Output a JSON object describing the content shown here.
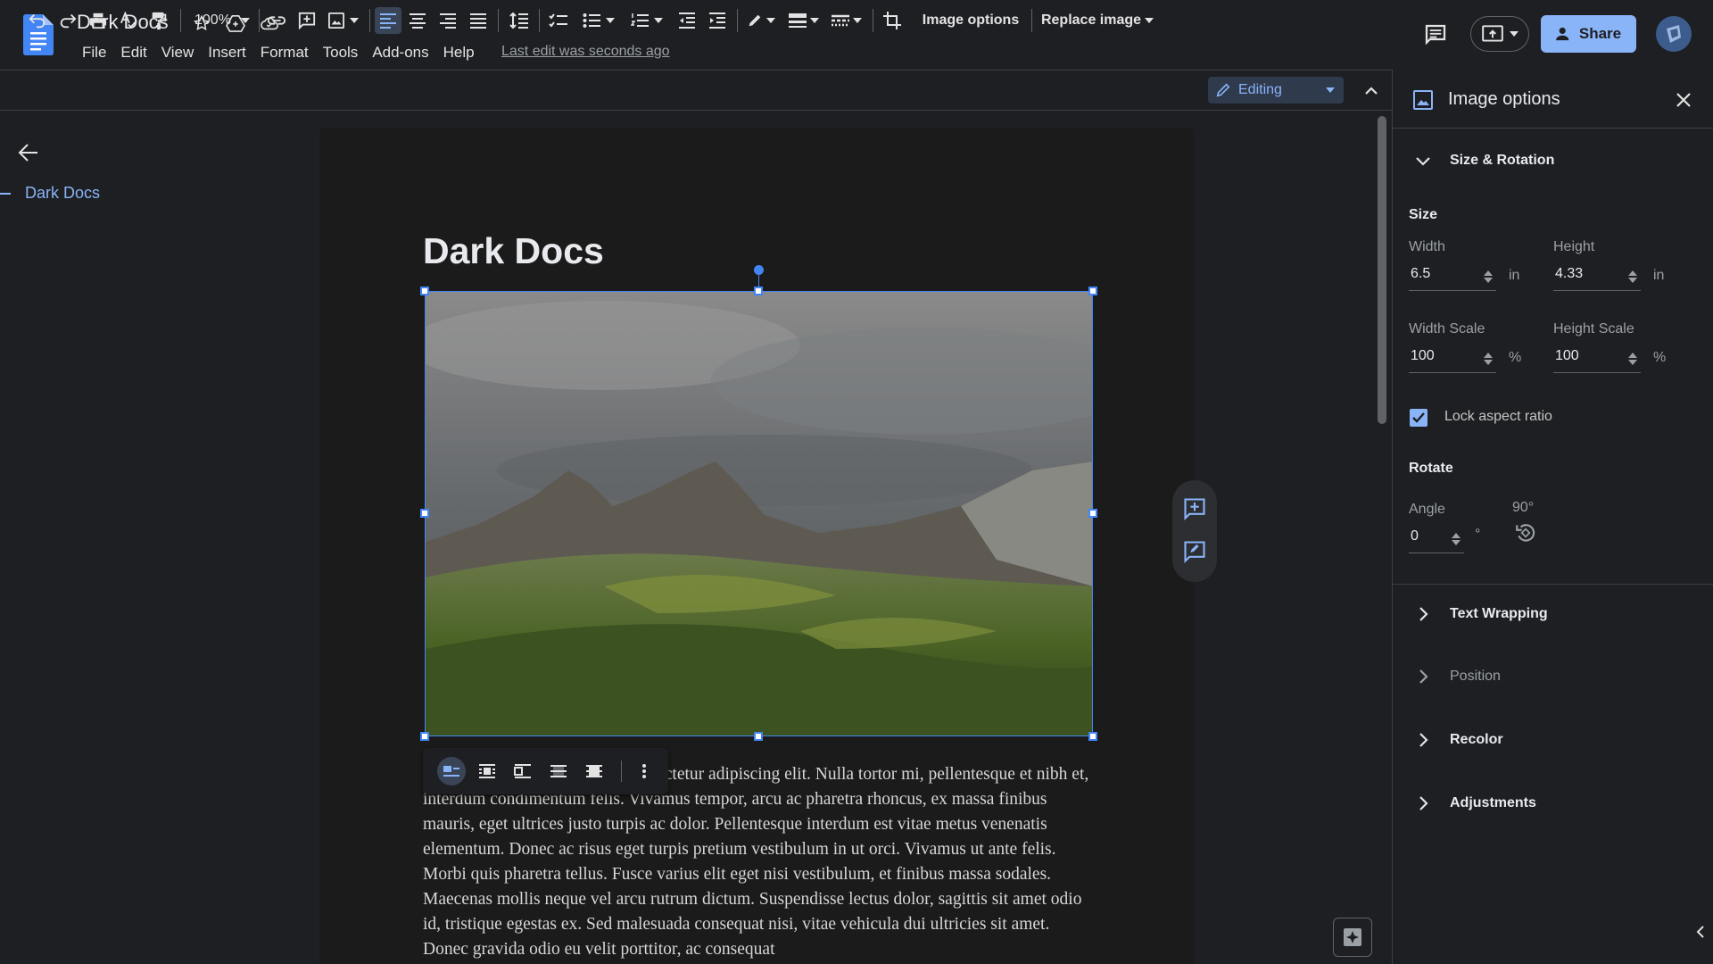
{
  "header": {
    "doc_title": "Dark Docs",
    "menu": [
      "File",
      "Edit",
      "View",
      "Insert",
      "Format",
      "Tools",
      "Add-ons",
      "Help"
    ],
    "last_edit": "Last edit was seconds ago",
    "share_label": "Share"
  },
  "toolbar": {
    "zoom": "100%",
    "image_options_label": "Image options",
    "replace_image_label": "Replace image",
    "mode_label": "Editing"
  },
  "outline": {
    "item": "Dark Docs"
  },
  "document": {
    "heading": "Dark Docs",
    "body": "Lorem ipsum dolor sit amet, consectetur adipiscing elit. Nulla tortor mi, pellentesque et nibh et, interdum condimentum felis. Vivamus tempor, arcu ac pharetra rhoncus, ex massa finibus mauris, eget ultrices justo turpis ac dolor. Pellentesque interdum est vitae metus venenatis elementum. Donec ac risus eget turpis pretium vestibulum in ut orci. Vivamus ut ante felis. Morbi quis pharetra tellus. Fusce varius elit eget nisi vestibulum, et finibus massa sodales. Maecenas mollis neque vel arcu rutrum dictum. Suspendisse lectus dolor, sagittis sit amet odio id, tristique egestas ex. Sed malesuada consequat nisi, vitae vehicula dui ultricies sit amet. Donec gravida odio eu velit porttitor, ac consequat"
  },
  "panel": {
    "title": "Image options",
    "size_rotation": "Size & Rotation",
    "size_label": "Size",
    "width_label": "Width",
    "width_value": "6.5",
    "width_unit": "in",
    "height_label": "Height",
    "height_value": "4.33",
    "height_unit": "in",
    "width_scale_label": "Width Scale",
    "width_scale_value": "100",
    "width_scale_unit": "%",
    "height_scale_label": "Height Scale",
    "height_scale_value": "100",
    "height_scale_unit": "%",
    "lock_aspect_label": "Lock aspect ratio",
    "lock_aspect_checked": true,
    "rotate_label": "Rotate",
    "angle_label": "Angle",
    "angle_value": "0",
    "angle_unit": "°",
    "rotate90_label": "90°",
    "text_wrapping": "Text Wrapping",
    "position": "Position",
    "recolor": "Recolor",
    "adjustments": "Adjustments"
  },
  "colors": {
    "accent": "#8ab4f8",
    "selection": "#4285f4",
    "background": "#1e1f22"
  }
}
